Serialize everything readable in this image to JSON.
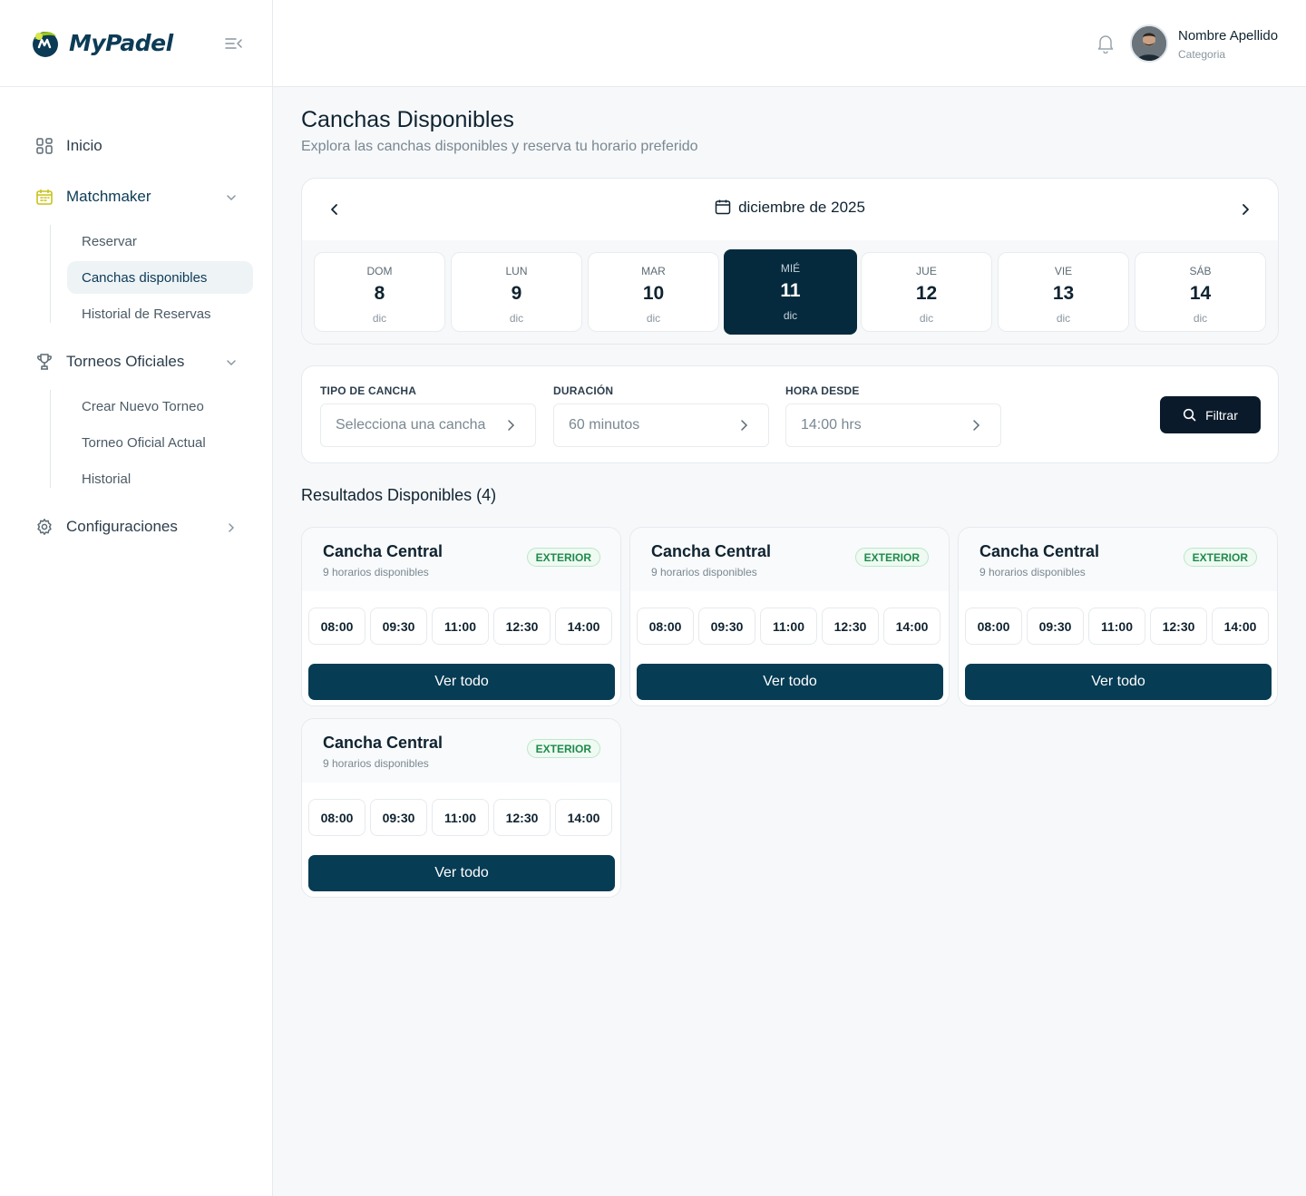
{
  "brand": {
    "name": "MyPadel"
  },
  "user": {
    "name": "Nombre Apellido",
    "category": "Categoria"
  },
  "sidebar": {
    "items": [
      {
        "label": "Inicio",
        "icon": "grid-icon"
      },
      {
        "label": "Matchmaker",
        "icon": "calendar-icon",
        "children": [
          {
            "label": "Reservar"
          },
          {
            "label": "Canchas disponibles"
          },
          {
            "label": "Historial de Reservas"
          }
        ]
      },
      {
        "label": "Torneos Oficiales",
        "icon": "trophy-icon",
        "children": [
          {
            "label": "Crear Nuevo Torneo"
          },
          {
            "label": "Torneo Oficial Actual"
          },
          {
            "label": "Historial"
          }
        ]
      },
      {
        "label": "Configuraciones",
        "icon": "gear-icon"
      }
    ]
  },
  "page": {
    "title": "Canchas Disponibles",
    "subtitle": "Explora las canchas disponibles y reserva tu horario preferido"
  },
  "calendar": {
    "month": "diciembre de 2025",
    "days": [
      {
        "name": "DOM",
        "num": "8",
        "month": "dic"
      },
      {
        "name": "LUN",
        "num": "9",
        "month": "dic"
      },
      {
        "name": "MAR",
        "num": "10",
        "month": "dic"
      },
      {
        "name": "MIÉ",
        "num": "11",
        "month": "dic"
      },
      {
        "name": "JUE",
        "num": "12",
        "month": "dic"
      },
      {
        "name": "VIE",
        "num": "13",
        "month": "dic"
      },
      {
        "name": "SÁB",
        "num": "14",
        "month": "dic"
      }
    ],
    "selected_day": "11"
  },
  "filters": {
    "court_type": {
      "label": "TIPO DE CANCHA",
      "value": "Selecciona una cancha"
    },
    "duration": {
      "label": "DURACIÓN",
      "value": "60 minutos"
    },
    "time_from": {
      "label": "HORA DESDE",
      "value": "14:00 hrs"
    },
    "button": "Filtrar"
  },
  "results": {
    "title": "Resultados Disponibles (4)",
    "courts": [
      {
        "name": "Cancha Central",
        "count": "9 horarios disponibles",
        "badge": "EXTERIOR",
        "slots": [
          "08:00",
          "09:30",
          "11:00",
          "12:30",
          "14:00"
        ],
        "button": "Ver todo"
      },
      {
        "name": "Cancha Central",
        "count": "9 horarios disponibles",
        "badge": "EXTERIOR",
        "slots": [
          "08:00",
          "09:30",
          "11:00",
          "12:30",
          "14:00"
        ],
        "button": "Ver todo"
      },
      {
        "name": "Cancha Central",
        "count": "9 horarios disponibles",
        "badge": "EXTERIOR",
        "slots": [
          "08:00",
          "09:30",
          "11:00",
          "12:30",
          "14:00"
        ],
        "button": "Ver todo"
      },
      {
        "name": "Cancha Central",
        "count": "9 horarios disponibles",
        "badge": "EXTERIOR",
        "slots": [
          "08:00",
          "09:30",
          "11:00",
          "12:30",
          "14:00"
        ],
        "button": "Ver todo"
      }
    ]
  },
  "colors": {
    "primary": "#063c54",
    "selected_day": "#052a3d",
    "accent_green": "#9cc51d",
    "badge_green": "#1f8a4c"
  }
}
